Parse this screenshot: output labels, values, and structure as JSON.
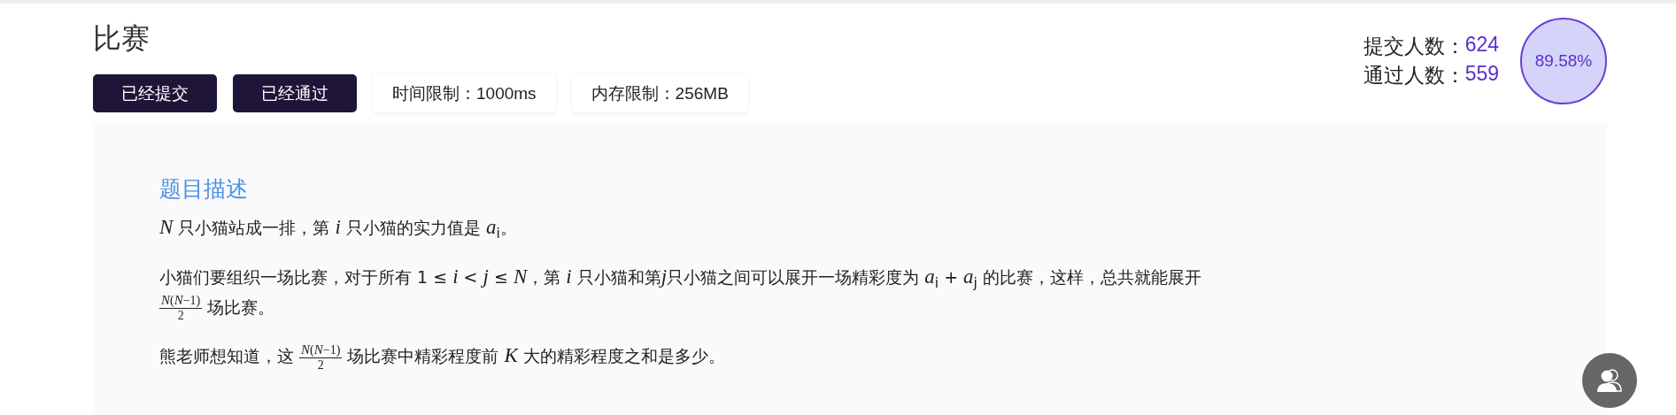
{
  "title": "比赛",
  "badges": [
    {
      "label": "已经提交",
      "kind": "status"
    },
    {
      "label": "已经通过",
      "kind": "status"
    },
    {
      "label": "时间限制：1000ms",
      "kind": "limit"
    },
    {
      "label": "内存限制：256MB",
      "kind": "limit"
    }
  ],
  "stats": [
    {
      "label": "提交人数：",
      "value": "624"
    },
    {
      "label": "通过人数：",
      "value": "559"
    }
  ],
  "pass_rate": "89.58%",
  "section_title": "题目描述",
  "paragraphs": [
    [
      {
        "kind": "text",
        "text": "*N* 只小猫站成一排，第 *i* 只小猫的实力值是 *a*$_{i}$。"
      }
    ],
    [
      {
        "kind": "text",
        "text": "小猫们要组织一场比赛，对于所有 1 ≤ *i* < *j* ≤ *N*，第 *i* 只小猫和第"
      },
      {
        "kind": "math",
        "text": "j"
      },
      {
        "kind": "text",
        "text": "只小猫之间可以展开一场精彩度为 *a*$_{i}$ + *a*$_{j}$ 的比赛，这样，总共就能展开"
      },
      {
        "kind": "break"
      },
      {
        "kind": "frac",
        "num": "*N*(*N*−1)",
        "den": "2"
      },
      {
        "kind": "text",
        "text": " 场比赛。"
      }
    ],
    [
      {
        "kind": "text",
        "text": "熊老师想知道，这 "
      },
      {
        "kind": "frac",
        "num": "*N*(*N*−1)",
        "den": "2"
      },
      {
        "kind": "text",
        "text": " 场比赛中精彩程度前 *K* 大的精彩程度之和是多少。"
      }
    ]
  ]
}
